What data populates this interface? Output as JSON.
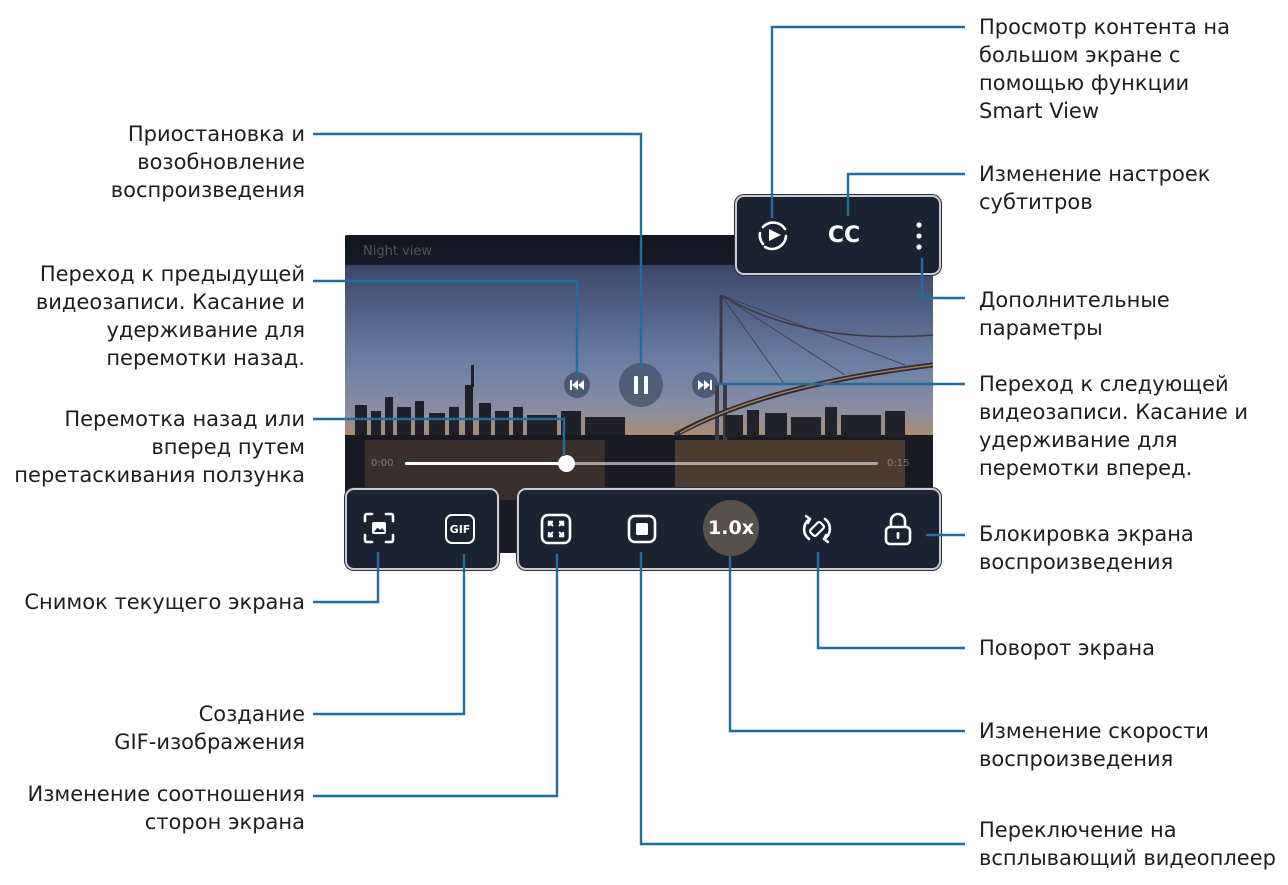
{
  "video": {
    "title": "Night view",
    "time_current": "0:00",
    "time_total": "0:15",
    "progress": 0.34
  },
  "controls": {
    "cc_label": "CC",
    "gif_label": "GIF",
    "speed_label": "1.0x"
  },
  "icons": [
    "smart-view-icon",
    "subtitle-cc-icon",
    "more-options-icon",
    "previous-video-icon",
    "pause-icon",
    "next-video-icon",
    "capture-icon",
    "gif-icon",
    "aspect-ratio-icon",
    "popup-player-icon",
    "rotate-screen-icon",
    "lock-icon"
  ],
  "labels": {
    "pause_resume": "Приостановка и\nвозобновление\nвоспроизведения",
    "previous": "Переход к предыдущей\nвидеозаписи. Касание и\nудерживание для\nперемотки назад.",
    "seek": "Перемотка назад или\nвперед путем\nперетаскивания ползунка",
    "capture": "Снимок текущего экрана",
    "gif": "Создание\nGIF-изображения",
    "aspect": "Изменение соотношения\nсторон экрана",
    "smart_view": "Просмотр контента на\nбольшом экране с\nпомощью функции\nSmart View",
    "subtitles": "Изменение настроек\nсубтитров",
    "more": "Дополнительные\nпараметры",
    "next": "Переход к следующей\nвидеозаписи. Касание и\nудерживание для\nперемотки вперед.",
    "lock": "Блокировка экрана\nвоспроизведения",
    "rotate": "Поворот экрана",
    "speed": "Изменение скорости\nвоспроизведения",
    "popup": "Переключение на\nвсплывающий видеоплеер"
  },
  "colors": {
    "leader_line": "#1f6e9c",
    "panel_bg": "#1b2232",
    "panel_border": "#c9ccd4",
    "text": "#1e1e1e"
  }
}
